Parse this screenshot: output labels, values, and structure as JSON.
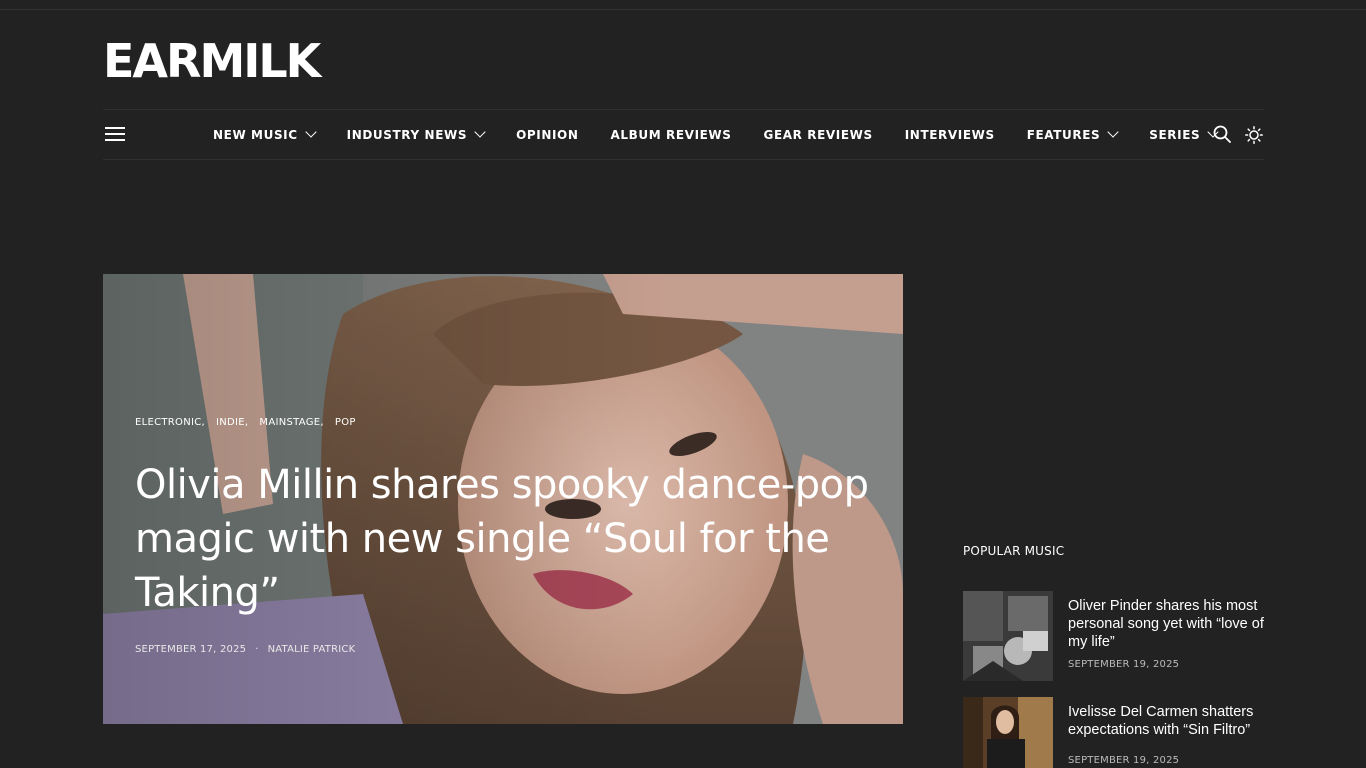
{
  "site": {
    "logo": "EARMILK"
  },
  "nav": {
    "items": [
      {
        "label": "NEW MUSIC",
        "dropdown": true
      },
      {
        "label": "INDUSTRY NEWS",
        "dropdown": true
      },
      {
        "label": "OPINION",
        "dropdown": false
      },
      {
        "label": "ALBUM REVIEWS",
        "dropdown": false
      },
      {
        "label": "GEAR REVIEWS",
        "dropdown": false
      },
      {
        "label": "INTERVIEWS",
        "dropdown": false
      },
      {
        "label": "FEATURES",
        "dropdown": true
      },
      {
        "label": "SERIES",
        "dropdown": true
      }
    ],
    "icons": {
      "menu": "hamburger-menu-icon",
      "search": "search-icon",
      "theme": "sun-icon"
    }
  },
  "hero": {
    "categories": [
      "ELECTRONIC,",
      "INDIE,",
      "MAINSTAGE,",
      "POP"
    ],
    "title": "Olivia Millin shares spooky dance-pop magic with new single “Soul for the Taking”",
    "date": "SEPTEMBER 17, 2025",
    "separator": "·",
    "author": "NATALIE PATRICK"
  },
  "popular": {
    "heading": "POPULAR MUSIC",
    "items": [
      {
        "title": "Oliver Pinder shares his most personal song yet with “love of my life”",
        "date": "SEPTEMBER 19, 2025"
      },
      {
        "title": "Ivelisse Del Carmen shatters expectations with “Sin Filtro”",
        "date": "SEPTEMBER 19, 2025"
      }
    ]
  },
  "colors": {
    "background": "#222222",
    "text": "#ffffff",
    "divider": "#303030"
  }
}
